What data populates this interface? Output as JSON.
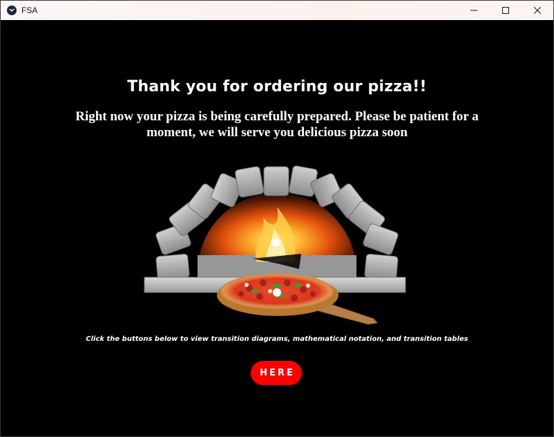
{
  "window": {
    "title": "FSA",
    "controls": [
      "minimize-icon",
      "maximize-icon",
      "close-icon"
    ]
  },
  "main": {
    "heading": "Thank you for ordering our pizza!!",
    "message": "Right now your pizza is being carefully prepared. Please be patient for a moment, we will serve you delicious pizza soon",
    "illustration": "pizza-oven-illustration",
    "hint": "Click the buttons below to view transition diagrams, mathematical notation, and transition tables",
    "button_label": "HERE"
  },
  "colors": {
    "background": "#000000",
    "button": "#ff0000",
    "text": "#ffffff"
  }
}
